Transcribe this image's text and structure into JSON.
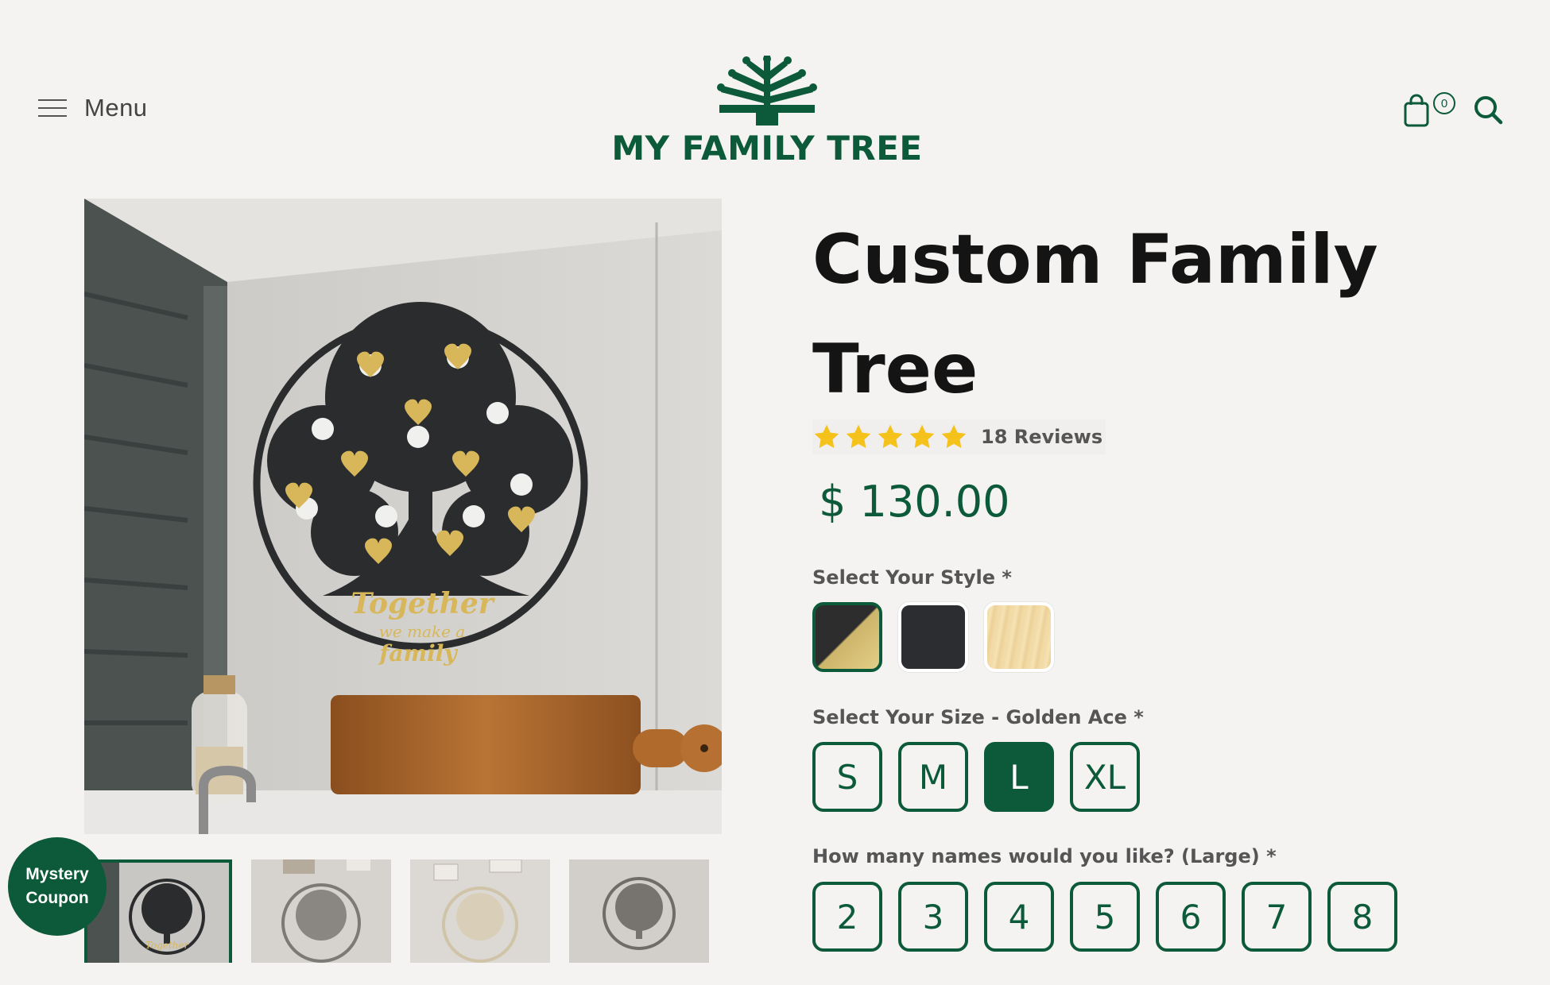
{
  "header": {
    "menu_label": "Menu",
    "logo_text": "MY FAMILY TREE",
    "cart_count": "0"
  },
  "gallery": {
    "main_alt": "Custom family tree wall art with gold names above a kitchen counter",
    "thumbnail_count": 4
  },
  "coupon": {
    "line1": "Mystery",
    "line2": "Coupon"
  },
  "product": {
    "title": "Custom Family Tree",
    "rating": 5,
    "reviews_label": "18 Reviews",
    "price": "$ 130.00"
  },
  "style": {
    "label": "Select Your Style *",
    "options": [
      {
        "name": "Golden Ace",
        "color": "#cdb56a",
        "selected": true
      },
      {
        "name": "Black",
        "color": "#2c2d30",
        "selected": false
      },
      {
        "name": "Wood",
        "color": "#f1d9a4",
        "selected": false
      }
    ]
  },
  "size": {
    "label": "Select Your Size - Golden Ace *",
    "options": [
      "S",
      "M",
      "L",
      "XL"
    ],
    "selected": "L"
  },
  "names": {
    "label": "How many names would you like? (Large) *",
    "options": [
      "2",
      "3",
      "4",
      "5",
      "6",
      "7",
      "8"
    ]
  },
  "colors": {
    "brand": "#0c5a3a",
    "star": "#f5c21b",
    "background": "#f4f3f1"
  }
}
